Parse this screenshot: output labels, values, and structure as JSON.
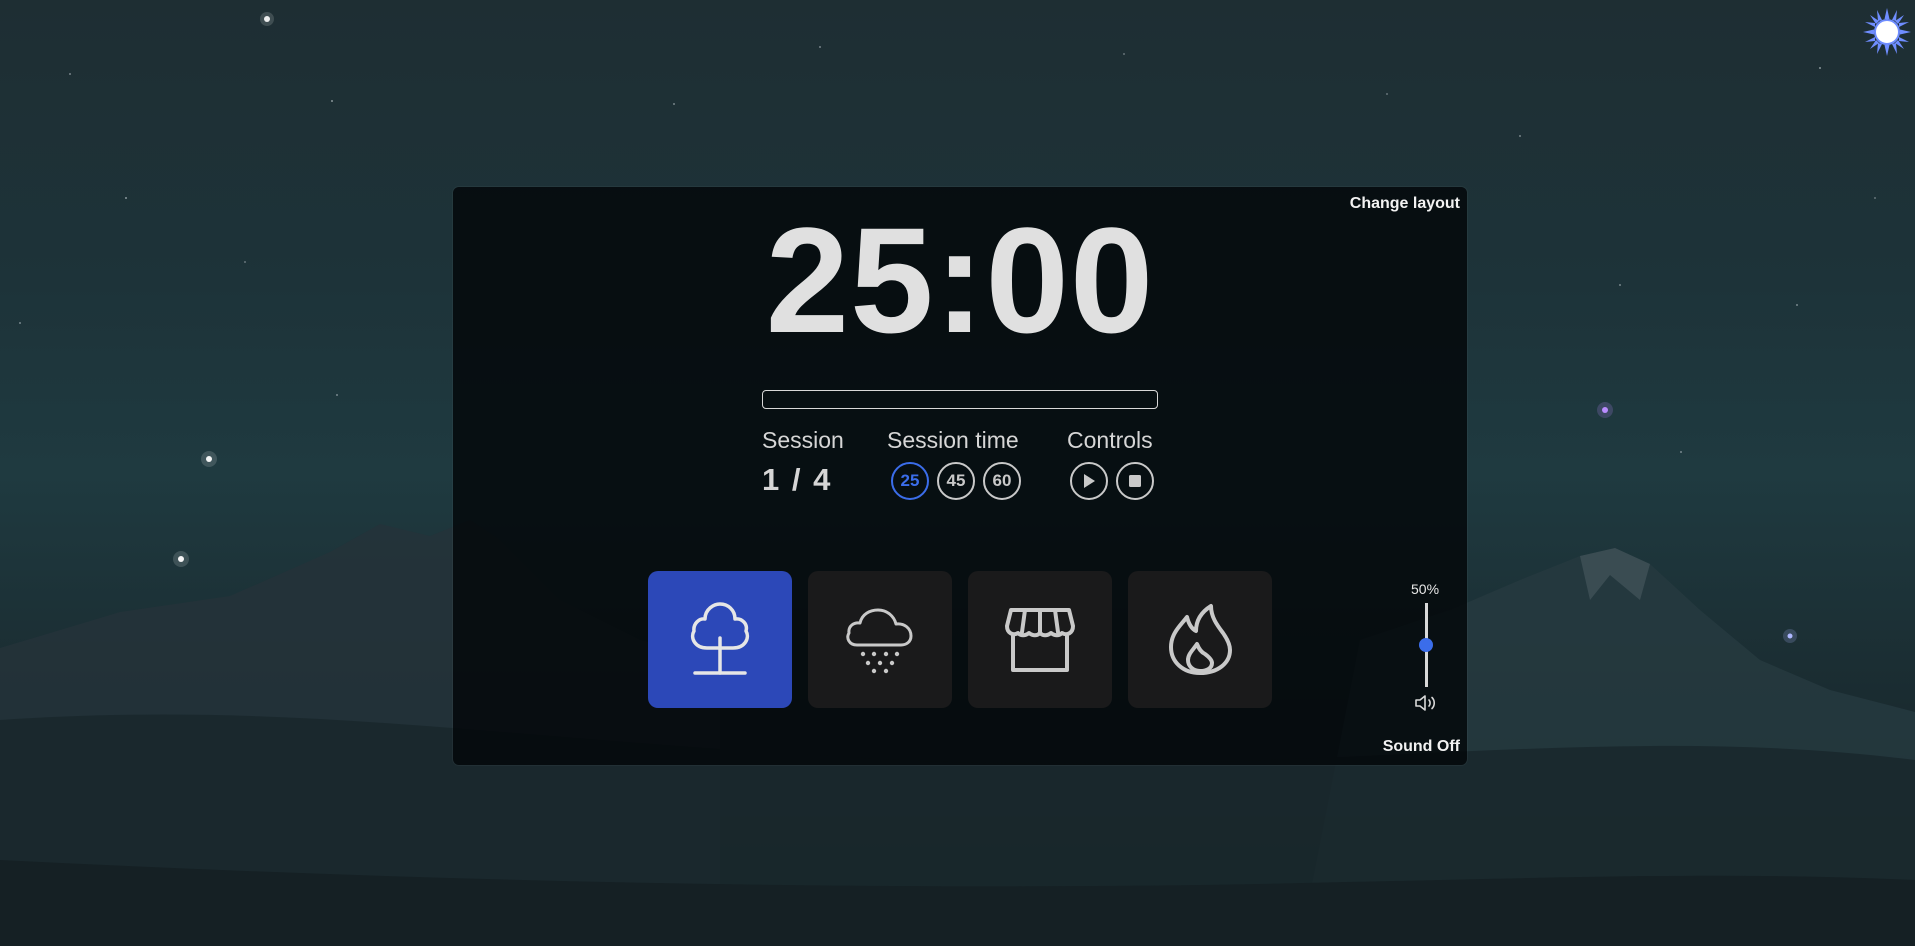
{
  "header": {
    "theme_toggle_icon": "sun-icon"
  },
  "panel": {
    "change_layout_label": "Change layout",
    "timer": "25:00",
    "progress_fraction": 0,
    "session": {
      "label": "Session",
      "value": "1 / 4"
    },
    "session_time": {
      "label": "Session time",
      "options": [
        "25",
        "45",
        "60"
      ],
      "selected": "25"
    },
    "controls": {
      "label": "Controls",
      "buttons": [
        {
          "name": "play",
          "icon": "play-icon"
        },
        {
          "name": "stop",
          "icon": "stop-icon"
        }
      ]
    },
    "sounds": [
      {
        "name": "forest",
        "icon": "tree-icon",
        "active": true
      },
      {
        "name": "rain",
        "icon": "snow-cloud-icon",
        "active": false
      },
      {
        "name": "cafe",
        "icon": "storefront-icon",
        "active": false
      },
      {
        "name": "fire",
        "icon": "flame-icon",
        "active": false
      }
    ],
    "volume": {
      "label": "50%",
      "level": 0.5,
      "icon": "speaker-icon"
    },
    "sound_toggle_label": "Sound Off"
  },
  "colors": {
    "accent": "#3b6dea",
    "active_tile": "#2c48b8",
    "tile": "#1a1a1b",
    "panel": "#030608",
    "text": "#e0e0e0"
  }
}
